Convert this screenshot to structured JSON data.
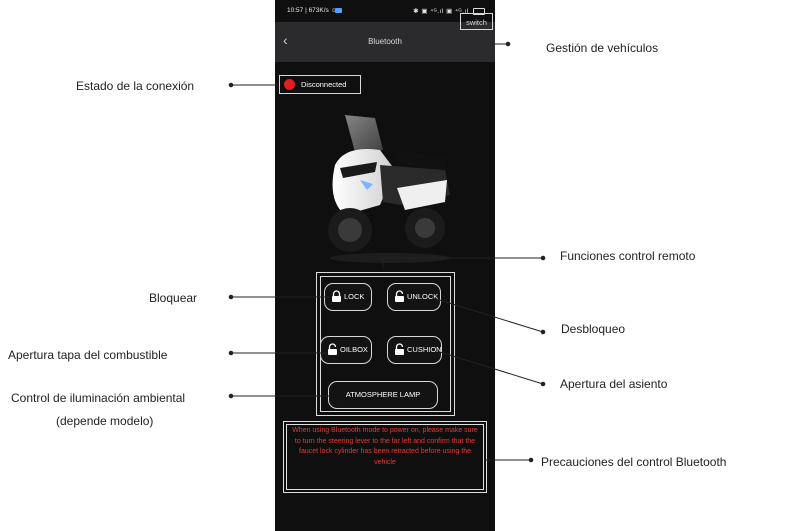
{
  "status_bar": {
    "time": "10:57 | 673K/s ☺",
    "icons": "✱ ▣ ⁴ᴳ.ıl ▣ ⁴ᴳ.ıl"
  },
  "app_bar": {
    "back_icon": "‹",
    "title": "Bluetooth",
    "switch_label": "switch"
  },
  "connection": {
    "state": "Disconnected",
    "led_color": "#e11d1d"
  },
  "remote": {
    "lock": "LOCK",
    "unlock": "UNLOCK",
    "oilbox": "OILBOX",
    "cushion": "CUSHION",
    "atmosphere_lamp": "ATMOSPHERE LAMP"
  },
  "warning": {
    "text": "When using Bluetooth mode to power on, please make sure to turn the steering lever to the far left and confirm that the faucet lock cylinder has been retracted before using the vehicle",
    "color": "#e53935"
  },
  "annotations": {
    "vehicle_management": "Gestión de vehículos",
    "connection_state": "Estado de la conexión",
    "remote_functions": "Funciones control remoto",
    "lock": "Bloquear",
    "unlock": "Desbloqueo",
    "fuel_cap": "Apertura tapa del combustible",
    "seat": "Apertura del asiento",
    "ambient_light_line1": "Control de iluminación ambiental",
    "ambient_light_line2": "(depende modelo)",
    "bt_precautions": "Precauciones del control Bluetooth"
  }
}
